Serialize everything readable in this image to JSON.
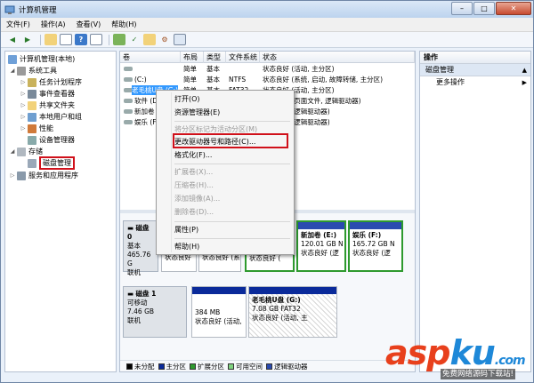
{
  "window": {
    "title": "计算机管理",
    "min": "–",
    "max": "□",
    "close": "✕"
  },
  "menu": [
    "文件(F)",
    "操作(A)",
    "查看(V)",
    "帮助(H)"
  ],
  "tree": {
    "root": "计算机管理(本地)",
    "system_tools": "系统工具",
    "task_scheduler": "任务计划程序",
    "event_viewer": "事件查看器",
    "shared_folders": "共享文件夹",
    "local_users": "本地用户和组",
    "performance": "性能",
    "device_manager": "设备管理器",
    "storage": "存储",
    "disk_management": "磁盘管理",
    "services_apps": "服务和应用程序"
  },
  "columns": [
    "卷",
    "布局",
    "类型",
    "文件系统",
    "状态"
  ],
  "volumes": [
    {
      "name": "",
      "layout": "简单",
      "type": "基本",
      "fs": "",
      "status": "状态良好 (活动, 主分区)"
    },
    {
      "name": "(C:)",
      "layout": "简单",
      "type": "基本",
      "fs": "NTFS",
      "status": "状态良好 (系统, 启动, 故障转储, 主分区)"
    },
    {
      "name": "老毛桃U盘 (G:)",
      "layout": "简单",
      "type": "基本",
      "fs": "FAT32",
      "status": "状态良好 (活动, 主分区)"
    },
    {
      "name": "软件 (D:)",
      "layout": "",
      "type": "",
      "fs": "",
      "status": "状态良好 (页面文件, 逻辑驱动器)"
    },
    {
      "name": "新加卷",
      "layout": "",
      "type": "",
      "fs": "",
      "status": "状态良好 (逻辑驱动器)"
    },
    {
      "name": "娱乐 (F:)",
      "layout": "",
      "type": "",
      "fs": "",
      "status": "状态良好 (逻辑驱动器)"
    }
  ],
  "context_menu": {
    "open": "打开(O)",
    "explorer": "资源管理器(E)",
    "mark_active": "将分区标记为活动分区(M)",
    "change_letter": "更改驱动器号和路径(C)...",
    "format": "格式化(F)...",
    "extend": "扩展卷(X)...",
    "shrink": "压缩卷(H)...",
    "mirror": "添加镜像(A)...",
    "delete": "删除卷(D)...",
    "properties": "属性(P)",
    "help": "帮助(H)"
  },
  "disk0": {
    "name": "磁盘 0",
    "type": "基本",
    "size": "465.76 G",
    "status": "联机",
    "p1_status": "状态良好",
    "p2_status": "状态良好 (系",
    "p3_status": "状态良好 (",
    "p4_name": "新加卷 (E:)",
    "p4_size": "120.01 GB N",
    "p4_status": "状态良好 (逻",
    "p5_name": "娱乐 (F:)",
    "p5_size": "165.72 GB N",
    "p5_status": "状态良好 (逻"
  },
  "disk1": {
    "name": "磁盘 1",
    "type": "可移动",
    "size": "7.46 GB",
    "status": "联机",
    "p1_size": "384 MB",
    "p1_status": "状态良好 (活动,",
    "p2_name": "老毛桃U盘 (G:)",
    "p2_size": "7.08 GB FAT32",
    "p2_status": "状态良好 (活动, 主"
  },
  "legend": [
    "未分配",
    "主分区",
    "扩展分区",
    "可用空间",
    "逻辑驱动器"
  ],
  "legend_colors": [
    "#000000",
    "#0a2a9a",
    "#2e9a2e",
    "#7fd27f",
    "#2a4ab0"
  ],
  "actions": {
    "header": "操作",
    "section": "磁盘管理",
    "more": "更多操作"
  },
  "watermark": {
    "brand_a": "asp",
    "brand_b": "ku",
    "suffix": ".com",
    "tagline": "免费网络源码下载站!"
  }
}
